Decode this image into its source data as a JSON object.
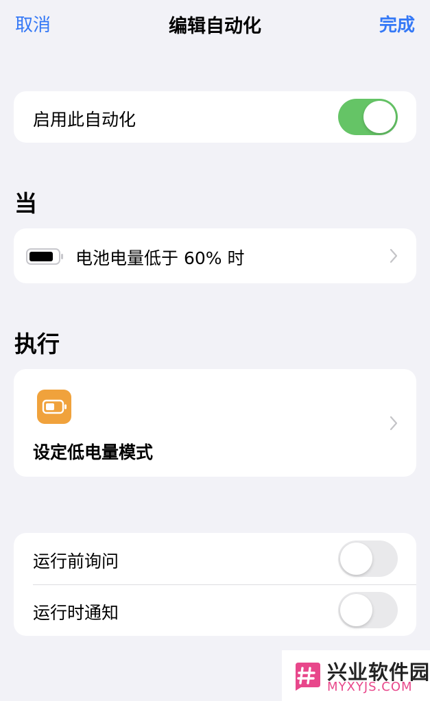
{
  "nav": {
    "cancel": "取消",
    "title": "编辑自动化",
    "done": "完成"
  },
  "enable_card": {
    "label": "启用此自动化",
    "enabled": true
  },
  "when": {
    "header": "当",
    "trigger": {
      "icon": "battery-icon",
      "label": "电池电量低于 60% 时"
    }
  },
  "do": {
    "header": "执行",
    "action": {
      "icon": "low-power-mode-icon",
      "label": "设定低电量模式",
      "icon_color": "#f0a23c"
    }
  },
  "options": [
    {
      "label": "运行前询问",
      "enabled": false
    },
    {
      "label": "运行时通知",
      "enabled": false
    }
  ],
  "watermark": {
    "cn": "兴业软件园",
    "en": "MYXYJS.COM"
  },
  "colors": {
    "accent": "#3478f6",
    "toggle_on": "#65c466",
    "background": "#f2f2f7"
  }
}
